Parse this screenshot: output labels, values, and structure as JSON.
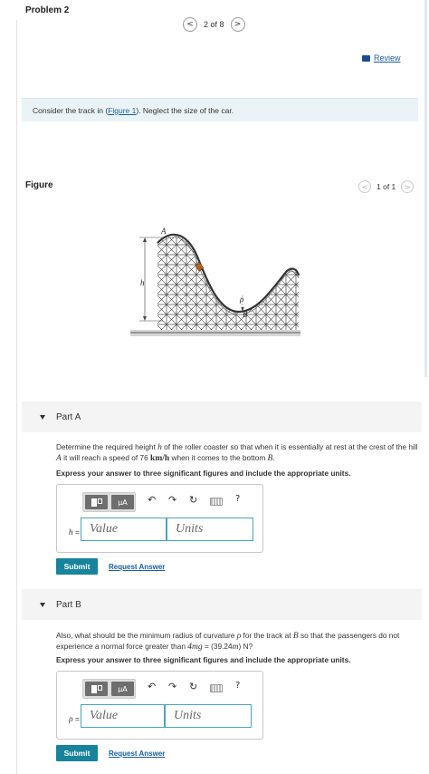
{
  "problem": {
    "title": "Problem 2"
  },
  "pager": {
    "prev": "<",
    "label": "2 of 8",
    "next": ">"
  },
  "review": {
    "label": "Review"
  },
  "intro": {
    "before": "Consider the track in (",
    "link": "Figure 1",
    "after": "). Neglect the size of the car."
  },
  "figure": {
    "label": "Figure",
    "pager": {
      "prev": "<",
      "label": "1 of 1",
      "next": ">"
    },
    "labels": {
      "top_point": "A",
      "height": "h",
      "radius": "ρ",
      "bottom_point": "B"
    }
  },
  "toolbar": {
    "unit_button": "μA",
    "undo": "↶",
    "redo": "↷",
    "reset": "↻",
    "help": "?"
  },
  "part_a": {
    "caret": "▼",
    "title": "Part A",
    "q_1": "Determine the required height ",
    "q_var_h": "h",
    "q_2": " of the roller coaster so that when it is essentially at rest at the crest of the hill ",
    "q_var_a": "A",
    "q_3": " it will reach a speed of 76 ",
    "q_unit": "km/h",
    "q_4": " when it comes to the bottom ",
    "q_var_b": "B",
    "q_5": ".",
    "instruction": "Express your answer to three significant figures and include the appropriate units.",
    "var_name": "h",
    "var_eq": " =",
    "value_placeholder": "Value",
    "units_placeholder": "Units",
    "submit": "Submit",
    "request": "Request Answer"
  },
  "part_b": {
    "caret": "▼",
    "title": "Part B",
    "q_1": "Also, what should be the minimum radius of curvature ",
    "q_var_rho": "ρ",
    "q_2": " for the track at ",
    "q_var_b": "B",
    "q_3": " so that the passengers do not experience a normal force greater than ",
    "q_expr": "4mg",
    "q_4": " = (39.24",
    "q_var_m": "m",
    "q_5": ") N?",
    "instruction": "Express your answer to three significant figures and include the appropriate units.",
    "var_name": "ρ",
    "var_eq": " =",
    "value_placeholder": "Value",
    "units_placeholder": "Units",
    "submit": "Submit",
    "request": "Request Answer"
  }
}
